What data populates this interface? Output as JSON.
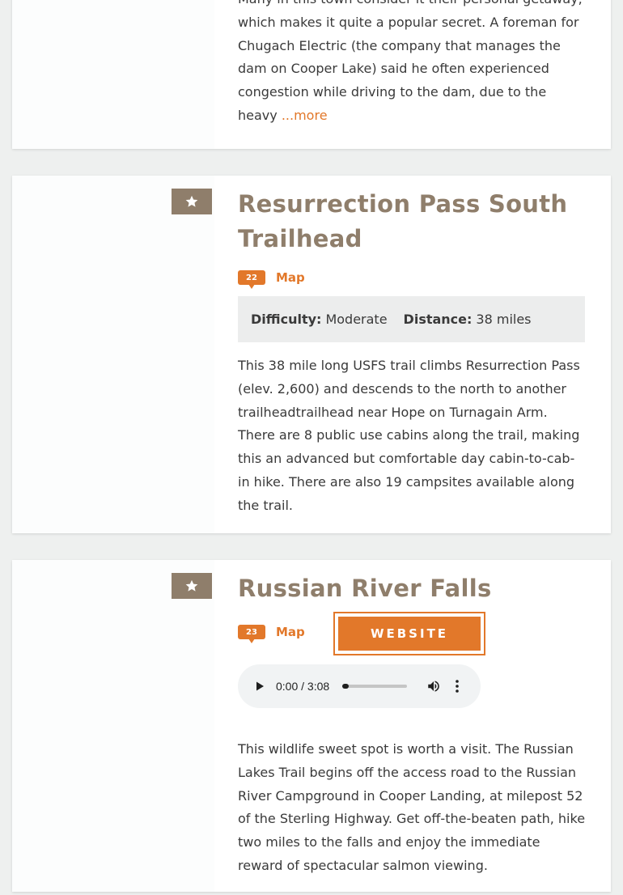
{
  "cards": [
    {
      "description": "Many in this town consider it their personal getaway, which makes it quite a popular secret. A foreman for Chugach Electric (the company that manages the dam on Cooper Lake) said he often experienced congestion while driving to the dam, due to the heavy",
      "more_label": "...more"
    },
    {
      "title_line1": "Resurrection Pass South",
      "title_line2": "Trailhead",
      "pin_number": "22",
      "map_label": "Map",
      "difficulty_label": "Difficulty:",
      "difficulty_value": "Moderate",
      "distance_label": "Distance:",
      "distance_value": "38 miles",
      "description": "This 38 mile long USFS trail climbs Resurrection Pass (elev. 2,600) and descends to the north to another trailheadtrailhead near Hope on Turnagain Arm. There are 8 public use cabins along the trail, making this an advanced but comfortable day cabin-to-cab-in hike. There are also 19 campsites available along the trail."
    },
    {
      "title": "Russian River Falls",
      "pin_number": "23",
      "map_label": "Map",
      "website_label": "WEBSITE",
      "audio_time": "0:00 / 3:08",
      "description": "This wildlife sweet spot is worth a visit. The Russian Lakes Trail begins off the access road to the Russian River Campground in Cooper Landing, at milepost 52 of the Sterling Highway. Get off-the-beaten path, hike two miles to the falls and enjoy the immediate reward of spectacular salmon viewing."
    }
  ],
  "colors": {
    "accent": "#e2782a",
    "brand_brown": "#8f7e6b"
  },
  "icons": [
    "star-icon",
    "map-pin-icon",
    "play-icon",
    "volume-icon",
    "more-vert-icon"
  ]
}
